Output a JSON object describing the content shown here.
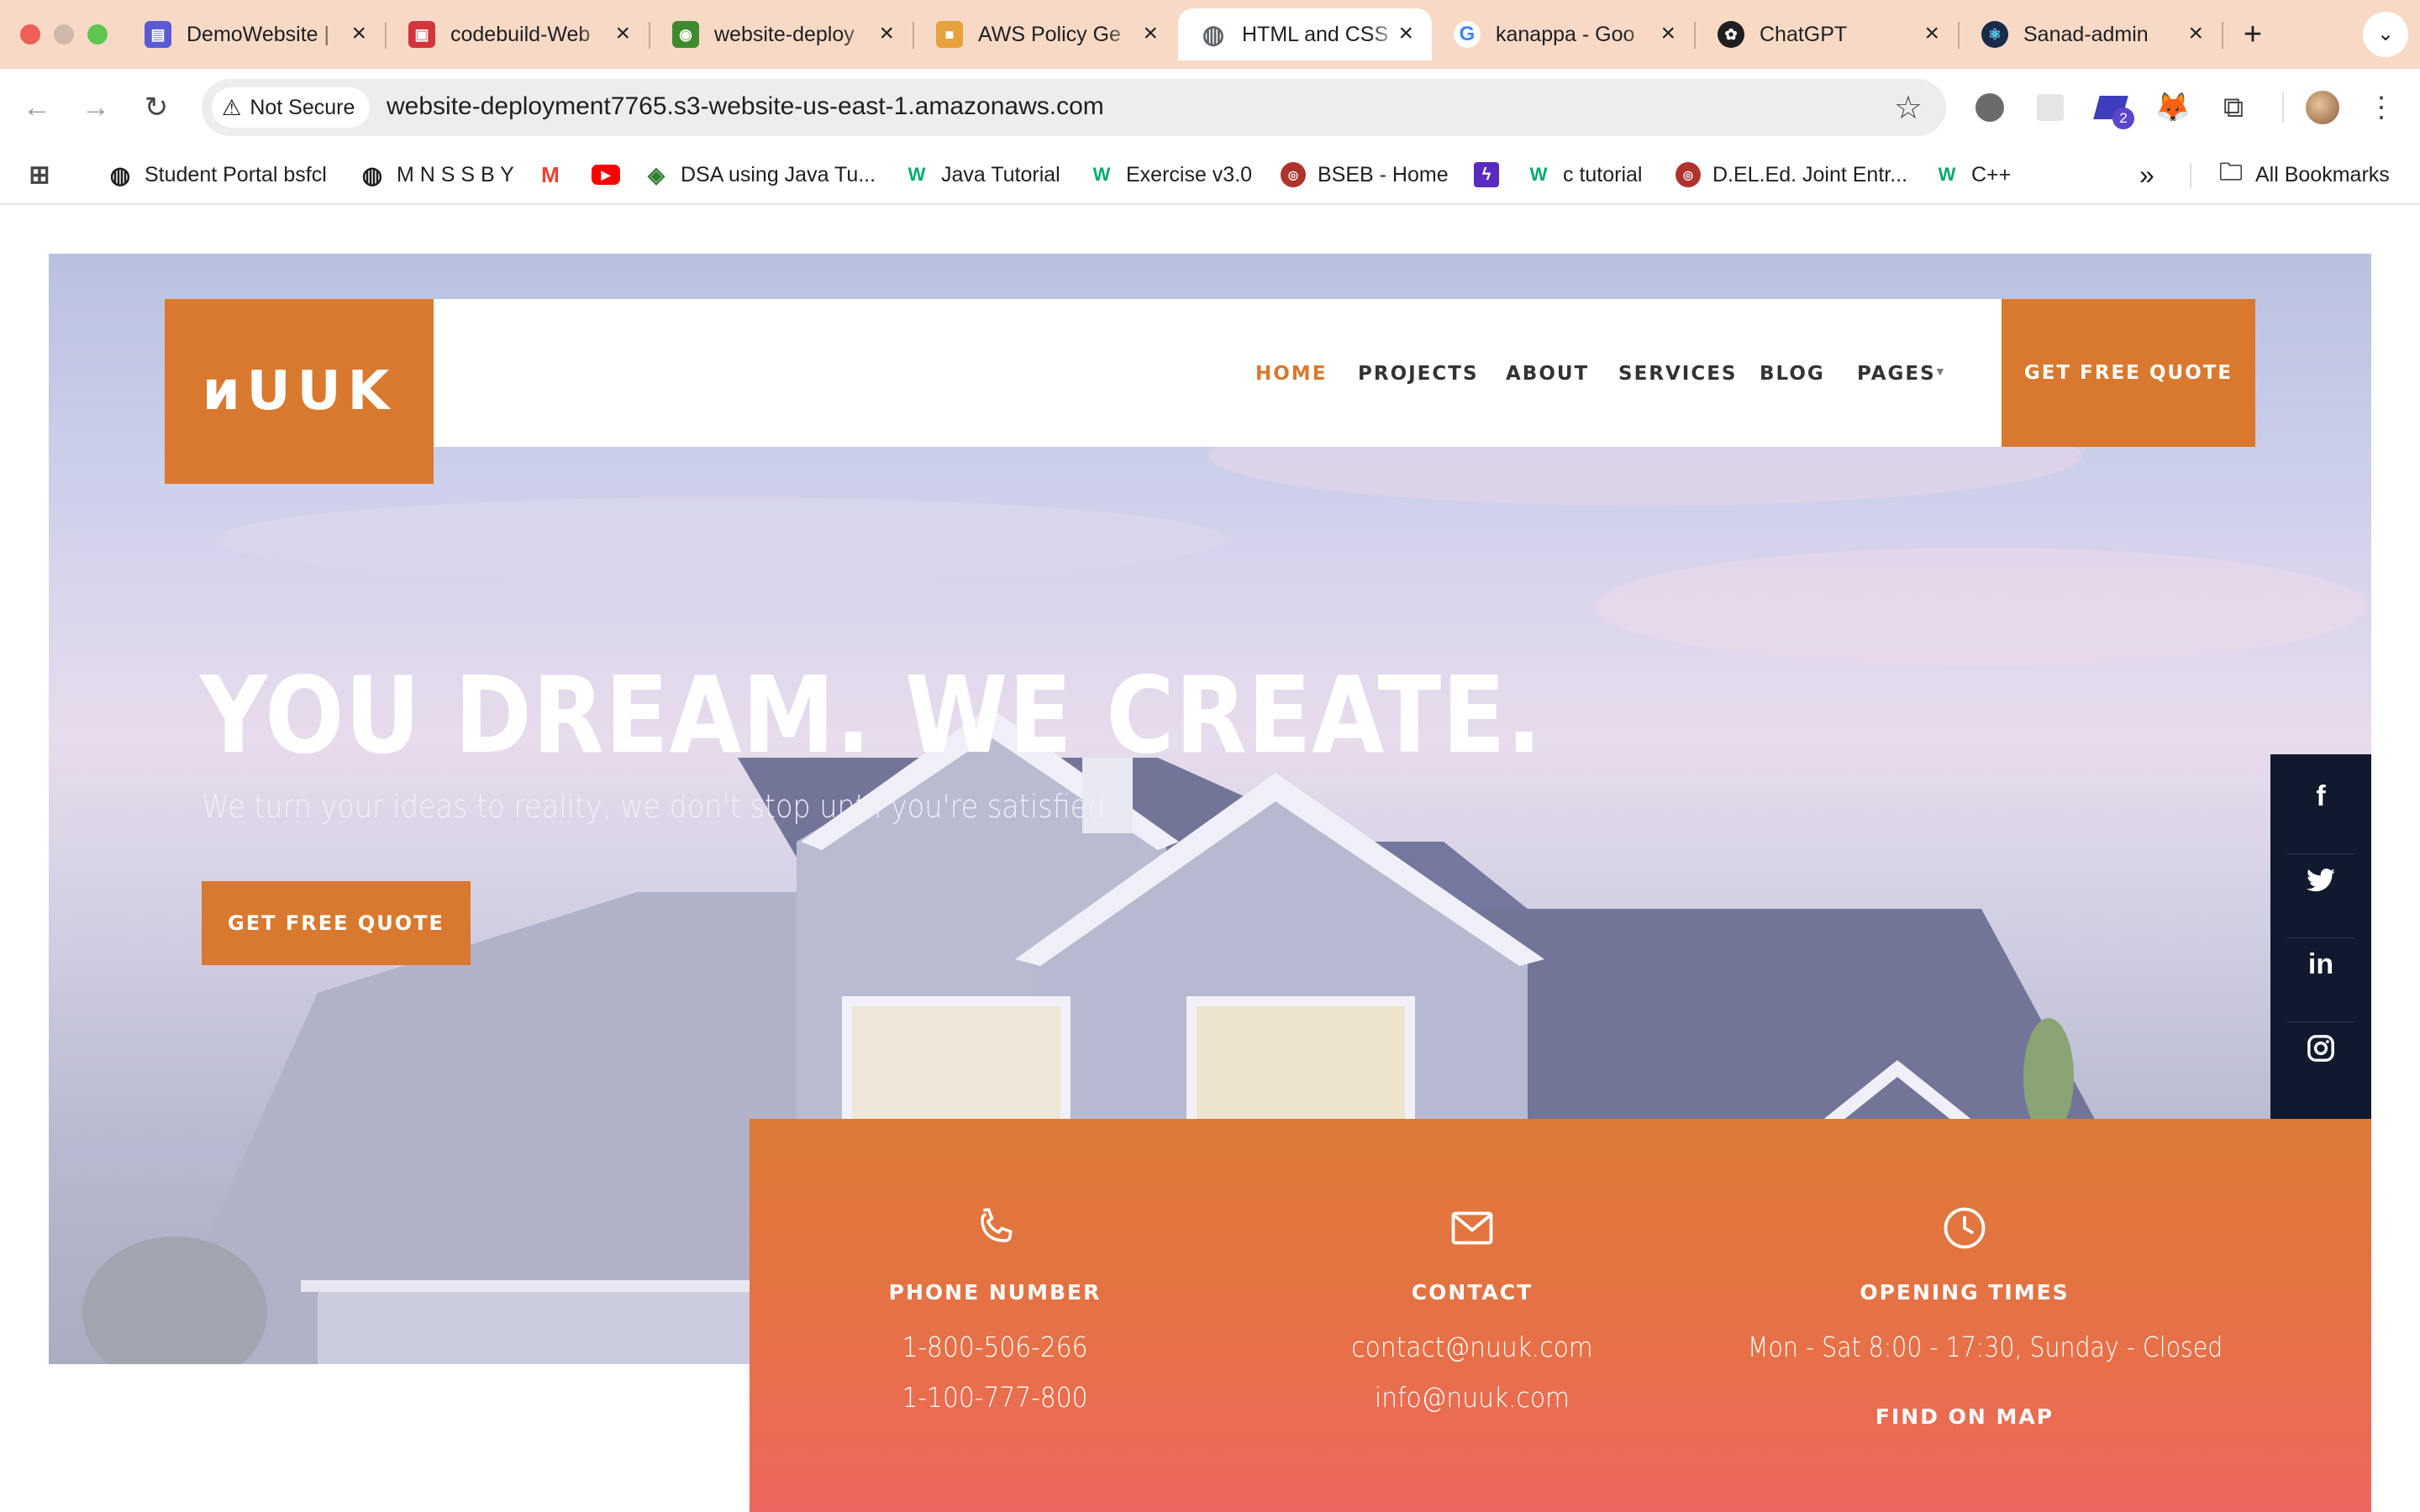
{
  "browser": {
    "tabs": [
      {
        "title": "DemoWebsite |",
        "favicon": "store-icon",
        "color": "#5a5ad6"
      },
      {
        "title": "codebuild-Web",
        "favicon": "codebuild-icon",
        "color": "#d4343c"
      },
      {
        "title": "website-deploy",
        "favicon": "s3-bucket-icon",
        "color": "#3f8a2f"
      },
      {
        "title": "AWS Policy Ge",
        "favicon": "box-icon",
        "color": "#e6a23c"
      },
      {
        "title": "HTML and CSS",
        "favicon": "globe-icon",
        "color": "#5f6368"
      },
      {
        "title": "kanappa - Goo",
        "favicon": "google-icon",
        "color": "#4285f4"
      },
      {
        "title": "ChatGPT",
        "favicon": "chatgpt-icon",
        "color": "#1f1f1f"
      },
      {
        "title": "Sanad-admin",
        "favicon": "react-icon",
        "color": "#1a2b4a"
      }
    ],
    "new_tab_symbol": "+",
    "security_label": "Not Secure",
    "url": "website-deployment7765.s3-website-us-east-1.amazonaws.com",
    "extension_badge": "2",
    "bookmarks": [
      {
        "label": "Student Portal bsfcl",
        "icon": "globe-icon"
      },
      {
        "label": "M N S S B Y",
        "icon": "globe-icon"
      },
      {
        "label": "",
        "icon": "gmail-icon"
      },
      {
        "label": "",
        "icon": "youtube-icon"
      },
      {
        "label": "DSA using Java Tu...",
        "icon": "dsa-icon"
      },
      {
        "label": "Java Tutorial",
        "icon": "w3schools-icon"
      },
      {
        "label": "Exercise v3.0",
        "icon": "w3schools-icon"
      },
      {
        "label": "BSEB - Home",
        "icon": "bseb-icon"
      },
      {
        "label": "",
        "icon": "bolt-icon"
      },
      {
        "label": "c tutorial",
        "icon": "w3schools-icon"
      },
      {
        "label": "D.EL.Ed. Joint Entr...",
        "icon": "bseb-icon"
      },
      {
        "label": "C++",
        "icon": "w3schools-icon"
      }
    ],
    "bookmarks_overflow": "»",
    "all_bookmarks": "All Bookmarks"
  },
  "site": {
    "logo": "ᴎUUK",
    "nav": [
      "HOME",
      "PROJECTS",
      "ABOUT",
      "SERVICES",
      "BLOG",
      "PAGES"
    ],
    "nav_quote": "GET FREE QUOTE",
    "headline": "YOU DREAM. WE CREATE.",
    "subline": "We turn your ideas to reality, we don't stop until you're satisfied.",
    "hero_button": "GET FREE QUOTE",
    "social": [
      "facebook-icon",
      "twitter-icon",
      "linkedin-icon",
      "instagram-icon"
    ],
    "social_text": {
      "facebook": "f",
      "linkedin": "in"
    },
    "info": {
      "phone": {
        "heading": "PHONE NUMBER",
        "lines": [
          "1-800-506-266",
          "1-100-777-800"
        ]
      },
      "contact": {
        "heading": "CONTACT",
        "lines": [
          "contact@nuuk.com",
          "info@nuuk.com"
        ]
      },
      "hours": {
        "heading": "OPENING TIMES",
        "lines": [
          "Mon - Sat 8:00 - 17:30, Sunday - Closed"
        ],
        "link": "FIND ON MAP"
      }
    },
    "colors": {
      "accent": "#d9792f",
      "dark": "#10192e",
      "active_nav": "#d9792f"
    }
  }
}
